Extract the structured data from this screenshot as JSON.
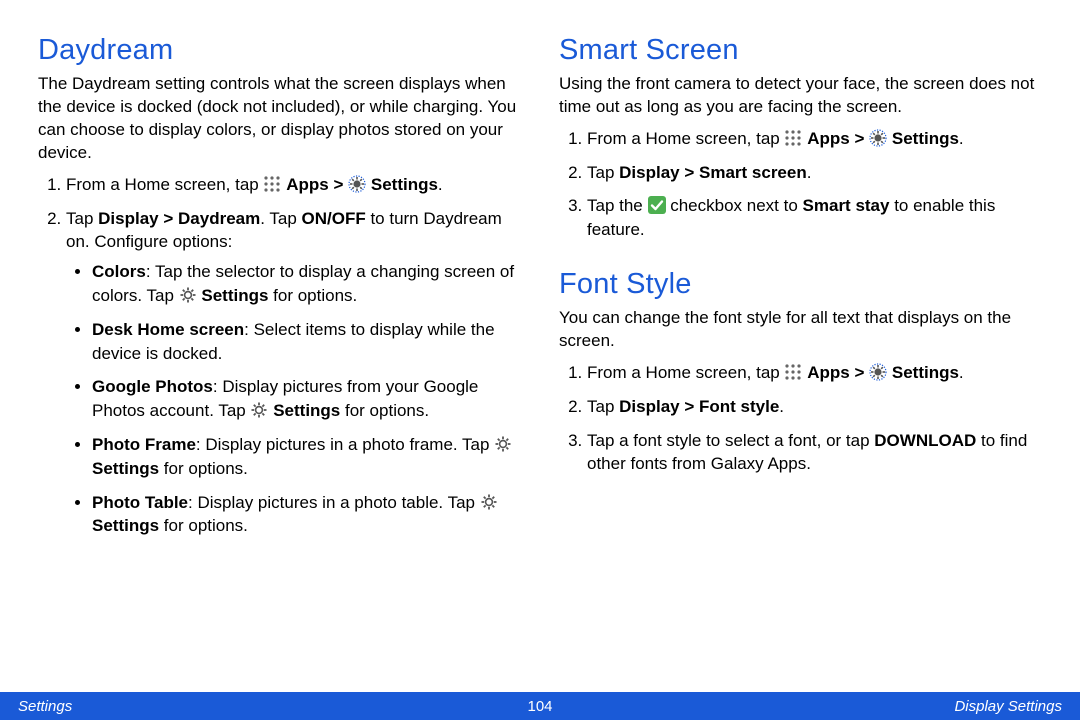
{
  "footer": {
    "left": "Settings",
    "page": "104",
    "right": "Display Settings"
  },
  "labels": {
    "apps": "Apps",
    "settings": "Settings",
    "for_options": "for options.",
    "from_home": "From a Home screen, tap",
    "tap": "Tap"
  },
  "left": {
    "h": "Daydream",
    "intro": "The Daydream setting controls what the screen displays when the device is docked (dock not included), or while charging. You can choose to display colors, or display photos stored on your device.",
    "step2_a": "Display > Daydream",
    "step2_b": ". Tap ",
    "step2_c": "ON/OFF",
    "step2_d": " to turn Daydream on. Configure options:",
    "b1_t": "Colors",
    "b1_x": ": Tap the selector to display a changing screen of colors. Tap ",
    "b2_t": "Desk Home screen",
    "b2_x": ": Select items to display while the device is docked.",
    "b3_t": "Google Photos",
    "b3_x": ": Display pictures from your Google Photos account. Tap ",
    "b4_t": "Photo Frame",
    "b4_x": ": Display pictures in a photo frame. Tap ",
    "b5_t": "Photo Table",
    "b5_x": ": Display pictures in a photo table. Tap "
  },
  "smart": {
    "h": "Smart Screen",
    "intro": "Using the front camera to detect your face, the screen does not time out as long as you are facing the screen.",
    "s2": "Display > Smart screen",
    "s3a": "Tap the ",
    "s3b": " checkbox next to ",
    "s3c": "Smart stay",
    "s3d": " to enable this feature."
  },
  "font": {
    "h": "Font Style",
    "intro": "You can change the font style for all text that displays on the screen.",
    "s2": "Display > Font style",
    "s3a": "Tap a font style to select a font, or tap ",
    "s3b": "DOWNLOAD",
    "s3c": " to find other fonts from Galaxy Apps."
  }
}
